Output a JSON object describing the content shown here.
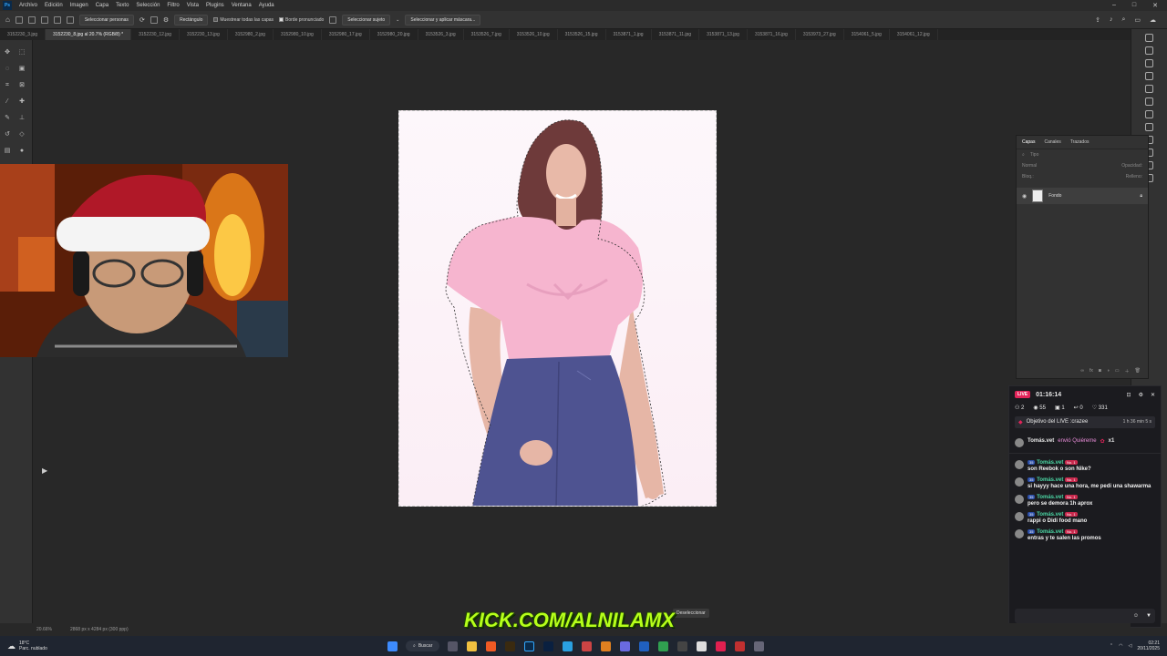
{
  "app": {
    "menu": [
      "Archivo",
      "Edición",
      "Imagen",
      "Capa",
      "Texto",
      "Selección",
      "Filtro",
      "Vista",
      "Plugins",
      "Ventana",
      "Ayuda"
    ]
  },
  "options_bar": {
    "select_people": "Seleccionar personas",
    "mode": "Rectángulo",
    "sample_all_layers": "Muestrear todas las capas",
    "hard_edge": "Borde pronunciado",
    "select_subject": "Seleccionar sujeto",
    "select_and_mask": "Seleccionar y aplicar máscara..."
  },
  "tabs": [
    {
      "label": "3152230_3.jpg",
      "active": false
    },
    {
      "label": "3152230_8.jpg al 20.7% (RGB/8) *",
      "active": true
    },
    {
      "label": "3152230_12.jpg",
      "active": false
    },
    {
      "label": "3152230_13.jpg",
      "active": false
    },
    {
      "label": "3152980_2.jpg",
      "active": false
    },
    {
      "label": "3152980_10.jpg",
      "active": false
    },
    {
      "label": "3152980_17.jpg",
      "active": false
    },
    {
      "label": "3152980_20.jpg",
      "active": false
    },
    {
      "label": "3153526_3.jpg",
      "active": false
    },
    {
      "label": "3153526_7.jpg",
      "active": false
    },
    {
      "label": "3153526_10.jpg",
      "active": false
    },
    {
      "label": "3153526_15.jpg",
      "active": false
    },
    {
      "label": "3153871_1.jpg",
      "active": false
    },
    {
      "label": "3153871_11.jpg",
      "active": false
    },
    {
      "label": "3153871_13.jpg",
      "active": false
    },
    {
      "label": "3153871_16.jpg",
      "active": false
    },
    {
      "label": "3153973_27.jpg",
      "active": false
    },
    {
      "label": "3154061_5.jpg",
      "active": false
    },
    {
      "label": "3154061_12.jpg",
      "active": false
    }
  ],
  "layers_panel": {
    "tabs": [
      "Capas",
      "Canales",
      "Trazados"
    ],
    "search_placeholder": "Tipo",
    "blend_mode": "Normal",
    "opacity_label": "Opacidad:",
    "lock_label": "Bloq.:",
    "fill_label": "Relleno:",
    "layer_name": "Fondo"
  },
  "live": {
    "badge": "LIVE",
    "timer": "01:16:14",
    "stats": {
      "users": "2",
      "views": "55",
      "gifts": "1",
      "shares": "0",
      "likes": "331"
    },
    "objective": "Objetivo del LIVE :crazee",
    "objective_time": "1 h 36 min 5 s",
    "gift": {
      "user": "Tomás.vet",
      "text": "envió Quiéreme",
      "count": "x1"
    },
    "messages": [
      {
        "user": "Tomás.vet",
        "text": "son Reebok o son Nike?"
      },
      {
        "user": "Tomás.vet",
        "text": "si hayyy hace una hora, me pedi una shawarma"
      },
      {
        "user": "Tomás.vet",
        "text": "pero se demora 1h aprox"
      },
      {
        "user": "Tomás.vet",
        "text": "rappi o Didi food mano"
      },
      {
        "user": "Tomás.vet",
        "text": "entras y te salen las promos"
      }
    ],
    "badge_level": "35",
    "badge_no": "No. 1"
  },
  "status": {
    "zoom": "20.66%",
    "doc_size": "2868 px x 4284 px (300 ppp)"
  },
  "contextual_bar": {
    "deselect": "Deseleccionar"
  },
  "watermark": "KICK.COM/ALNILAMX",
  "taskbar": {
    "weather_temp": "18°C",
    "weather_desc": "Parc. nublado",
    "search": "Buscar",
    "time": "02:21",
    "date": "20/11/2025"
  }
}
